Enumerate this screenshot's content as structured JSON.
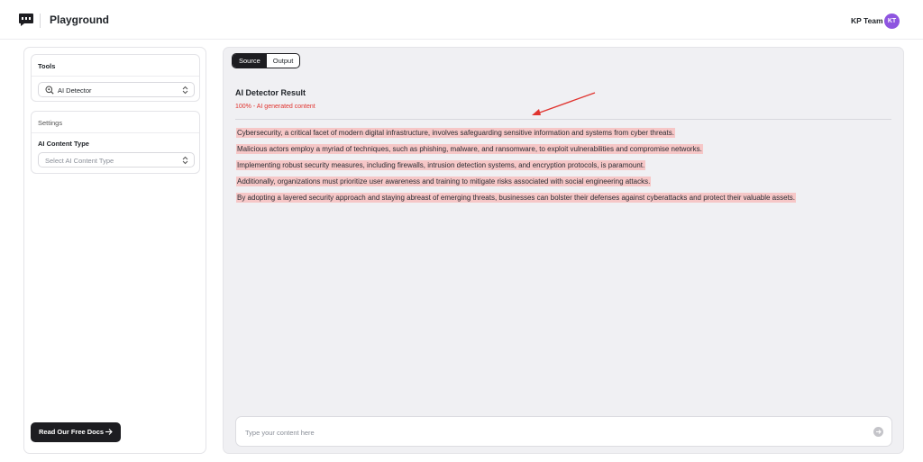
{
  "header": {
    "app_title": "Playground",
    "user_name": "KP Team",
    "avatar_initials": "KT",
    "avatar_color": "#8e55e0"
  },
  "sidebar": {
    "tools_heading": "Tools",
    "tool_select_value": "AI Detector",
    "settings_heading": "Settings",
    "content_type_label": "AI Content Type",
    "content_type_placeholder": "Select AI Content Type",
    "docs_button_label": "Read Our Free Docs"
  },
  "main": {
    "tabs": [
      {
        "label": "Source",
        "active": true
      },
      {
        "label": "Output",
        "active": false
      }
    ],
    "result_title": "AI Detector Result",
    "result_summary": "100% - AI generated content",
    "highlight_color": "#f6c7c7",
    "accent_color": "#e0342f",
    "lines": [
      "Cybersecurity, a critical facet of modern digital infrastructure, involves safeguarding sensitive information and systems from cyber threats.",
      "Malicious actors employ a myriad of techniques, such as phishing, malware, and ransomware, to exploit vulnerabilities and compromise networks.",
      "Implementing robust security measures, including firewalls, intrusion detection systems, and encryption protocols, is paramount.",
      "Additionally, organizations must prioritize user awareness and training to mitigate risks associated with social engineering attacks.",
      "By adopting a layered security approach and staying abreast of emerging threats, businesses can bolster their defenses against cyberattacks and protect their valuable assets."
    ],
    "composer": {
      "placeholder": "Type your content here",
      "value": ""
    }
  }
}
